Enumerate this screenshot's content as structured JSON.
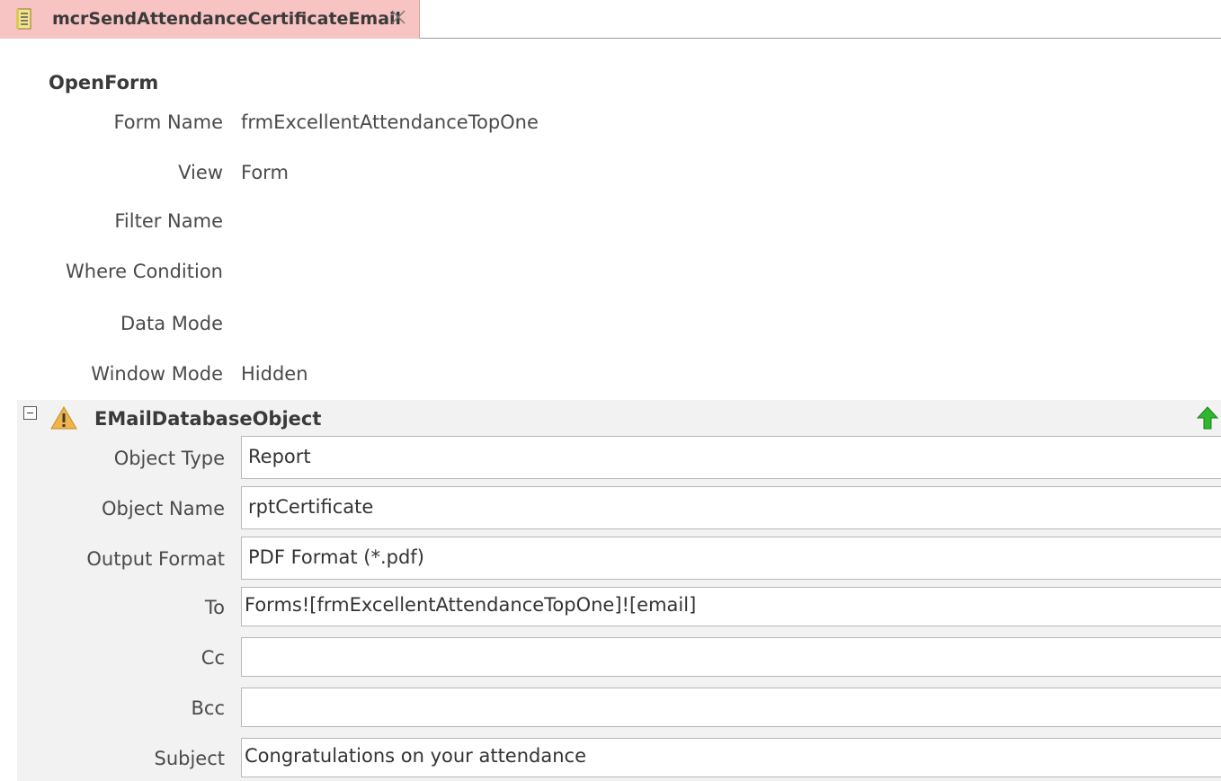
{
  "tab": {
    "icon": "macro-icon",
    "title": "mcrSendAttendanceCertificateEmail",
    "close_icon": "close-icon"
  },
  "open_form": {
    "title": "OpenForm",
    "arguments": [
      {
        "label": "Form Name",
        "value": "frmExcellentAttendanceTopOne"
      },
      {
        "label": "View",
        "value": "Form"
      },
      {
        "label": "Filter Name",
        "value": ""
      },
      {
        "label": "Where Condition",
        "value": ""
      },
      {
        "label": "Data Mode",
        "value": ""
      },
      {
        "label": "Window Mode",
        "value": "Hidden"
      }
    ]
  },
  "email_object": {
    "title": "EMailDatabaseObject",
    "warning_icon": "warning-icon",
    "move_up_icon": "move-up-arrow-icon",
    "collapse_icon": "collapse-minus-icon",
    "arguments": [
      {
        "label": "Object Type",
        "value": "Report"
      },
      {
        "label": "Object Name",
        "value": "rptCertificate"
      },
      {
        "label": "Output Format",
        "value": "PDF Format (*.pdf)"
      },
      {
        "label": "To",
        "value": "Forms![frmExcellentAttendanceTopOne]![email]"
      },
      {
        "label": "Cc",
        "value": ""
      },
      {
        "label": "Bcc",
        "value": ""
      },
      {
        "label": "Subject",
        "value": "Congratulations on your attendance"
      }
    ]
  },
  "colors": {
    "tab_active_bg": "#f7c3c3",
    "selected_block_bg": "#f2f2f2",
    "warning": "#e8a33d",
    "arrow_green": "#2eb82e"
  }
}
